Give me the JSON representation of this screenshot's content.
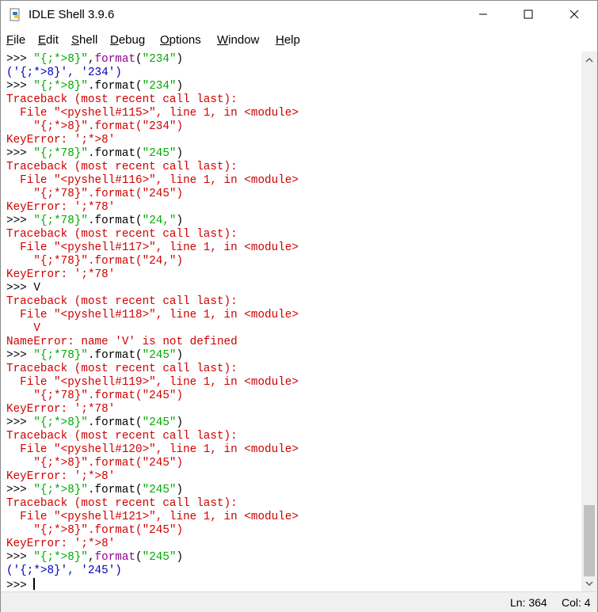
{
  "window": {
    "title": "IDLE Shell 3.9.6"
  },
  "menu": [
    "File",
    "Edit",
    "Shell",
    "Debug",
    "Options",
    "Window",
    "Help"
  ],
  "menu_underline": [
    "F",
    "E",
    "S",
    "D",
    "O",
    "W",
    "H"
  ],
  "lines": [
    [
      [
        "prompt",
        ">>> "
      ],
      [
        "str",
        "\"{;*>8}\""
      ],
      [
        "prompt",
        ","
      ],
      [
        "kw",
        "format"
      ],
      [
        "prompt",
        "("
      ],
      [
        "str",
        "\"234\""
      ],
      [
        "prompt",
        ")"
      ]
    ],
    [
      [
        "out",
        "('{;*>8}', '234')"
      ]
    ],
    [
      [
        "prompt",
        ">>> "
      ],
      [
        "str",
        "\"{;*>8}\""
      ],
      [
        "prompt",
        ".format("
      ],
      [
        "str",
        "\"234\""
      ],
      [
        "prompt",
        ")"
      ]
    ],
    [
      [
        "err",
        "Traceback (most recent call last):"
      ]
    ],
    [
      [
        "err",
        "  File \"<pyshell#115>\", line 1, in <module>"
      ]
    ],
    [
      [
        "err",
        "    \"{;*>8}\".format(\"234\")"
      ]
    ],
    [
      [
        "err",
        "KeyError: ';*>8'"
      ]
    ],
    [
      [
        "prompt",
        ">>> "
      ],
      [
        "str",
        "\"{;*78}\""
      ],
      [
        "prompt",
        ".format("
      ],
      [
        "str",
        "\"245\""
      ],
      [
        "prompt",
        ")"
      ]
    ],
    [
      [
        "err",
        "Traceback (most recent call last):"
      ]
    ],
    [
      [
        "err",
        "  File \"<pyshell#116>\", line 1, in <module>"
      ]
    ],
    [
      [
        "err",
        "    \"{;*78}\".format(\"245\")"
      ]
    ],
    [
      [
        "err",
        "KeyError: ';*78'"
      ]
    ],
    [
      [
        "prompt",
        ">>> "
      ],
      [
        "str",
        "\"{;*78}\""
      ],
      [
        "prompt",
        ".format("
      ],
      [
        "str",
        "\"24,\""
      ],
      [
        "prompt",
        ")"
      ]
    ],
    [
      [
        "err",
        "Traceback (most recent call last):"
      ]
    ],
    [
      [
        "err",
        "  File \"<pyshell#117>\", line 1, in <module>"
      ]
    ],
    [
      [
        "err",
        "    \"{;*78}\".format(\"24,\")"
      ]
    ],
    [
      [
        "err",
        "KeyError: ';*78'"
      ]
    ],
    [
      [
        "prompt",
        ">>> V"
      ]
    ],
    [
      [
        "err",
        "Traceback (most recent call last):"
      ]
    ],
    [
      [
        "err",
        "  File \"<pyshell#118>\", line 1, in <module>"
      ]
    ],
    [
      [
        "err",
        "    V"
      ]
    ],
    [
      [
        "err",
        "NameError: name 'V' is not defined"
      ]
    ],
    [
      [
        "prompt",
        ">>> "
      ],
      [
        "str",
        "\"{;*78}\""
      ],
      [
        "prompt",
        ".format("
      ],
      [
        "str",
        "\"245\""
      ],
      [
        "prompt",
        ")"
      ]
    ],
    [
      [
        "err",
        "Traceback (most recent call last):"
      ]
    ],
    [
      [
        "err",
        "  File \"<pyshell#119>\", line 1, in <module>"
      ]
    ],
    [
      [
        "err",
        "    \"{;*78}\".format(\"245\")"
      ]
    ],
    [
      [
        "err",
        "KeyError: ';*78'"
      ]
    ],
    [
      [
        "prompt",
        ">>> "
      ],
      [
        "str",
        "\"{;*>8}\""
      ],
      [
        "prompt",
        ".format("
      ],
      [
        "str",
        "\"245\""
      ],
      [
        "prompt",
        ")"
      ]
    ],
    [
      [
        "err",
        "Traceback (most recent call last):"
      ]
    ],
    [
      [
        "err",
        "  File \"<pyshell#120>\", line 1, in <module>"
      ]
    ],
    [
      [
        "err",
        "    \"{;*>8}\".format(\"245\")"
      ]
    ],
    [
      [
        "err",
        "KeyError: ';*>8'"
      ]
    ],
    [
      [
        "prompt",
        ">>> "
      ],
      [
        "str",
        "\"{;*>8}\""
      ],
      [
        "prompt",
        ".format("
      ],
      [
        "str",
        "\"245\""
      ],
      [
        "prompt",
        ")"
      ]
    ],
    [
      [
        "err",
        "Traceback (most recent call last):"
      ]
    ],
    [
      [
        "err",
        "  File \"<pyshell#121>\", line 1, in <module>"
      ]
    ],
    [
      [
        "err",
        "    \"{;*>8}\".format(\"245\")"
      ]
    ],
    [
      [
        "err",
        "KeyError: ';*>8'"
      ]
    ],
    [
      [
        "prompt",
        ">>> "
      ],
      [
        "str",
        "\"{;*>8}\""
      ],
      [
        "prompt",
        ","
      ],
      [
        "kw",
        "format"
      ],
      [
        "prompt",
        "("
      ],
      [
        "str",
        "\"245\""
      ],
      [
        "prompt",
        ")"
      ]
    ],
    [
      [
        "out",
        "('{;*>8}', '245')"
      ]
    ],
    [
      [
        "prompt",
        ">>> "
      ]
    ]
  ],
  "status": {
    "line": "Ln: 364",
    "col": "Col: 4"
  },
  "colors": {
    "string": "#00aa00",
    "builtin": "#900090",
    "output": "#0000c0",
    "error": "#d00000"
  },
  "icons": {
    "app": "python-idle-icon",
    "minimize": "minimize-icon",
    "maximize": "maximize-icon",
    "close": "close-icon"
  }
}
